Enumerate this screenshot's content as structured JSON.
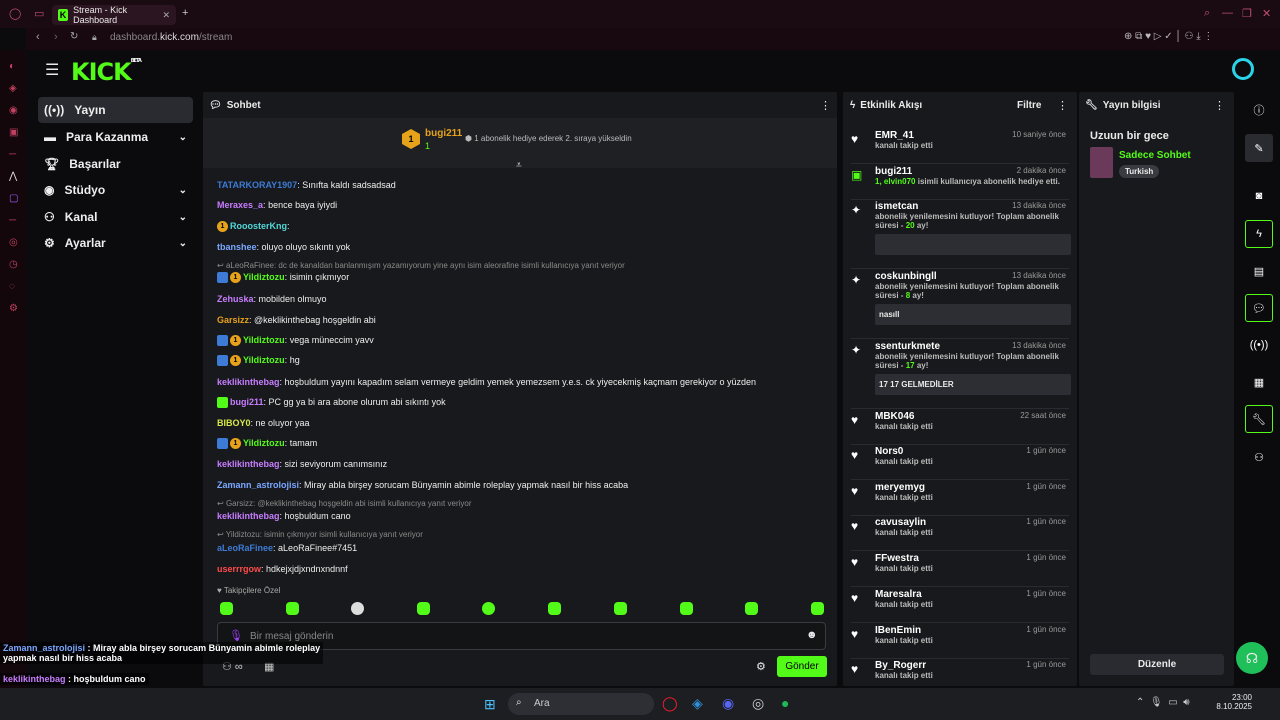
{
  "browser": {
    "tab_title": "Stream - Kick Dashboard",
    "address_domain_prefix": "dashboard.",
    "address_domain": "kick.com",
    "address_path": "/stream"
  },
  "brand": {
    "logo": "KICK",
    "beta": "BETA",
    "accent": "#53fc18"
  },
  "nav": [
    {
      "label": "Yayın",
      "icon": "broadcast-icon",
      "active": true
    },
    {
      "label": "Para Kazanma",
      "icon": "money-icon",
      "expandable": true
    },
    {
      "label": "Başarılar",
      "icon": "trophy-icon"
    },
    {
      "label": "Stüdyo",
      "icon": "studio-icon",
      "expandable": true
    },
    {
      "label": "Kanal",
      "icon": "channel-icon",
      "expandable": true
    },
    {
      "label": "Ayarlar",
      "icon": "settings-icon",
      "expandable": true
    }
  ],
  "chat": {
    "title": "Sohbet",
    "pinned": {
      "user": "bugi211",
      "count": "1",
      "text": "1 abonelik hediye ederek 2. sıraya yükseldin"
    },
    "messages": [
      {
        "user": "TATARKORAY1907",
        "color": "#3d7bd6",
        "text": "Sınıfta kaldı sadsadsad"
      },
      {
        "user": "Meraxes_a",
        "color": "#c77dff",
        "text": "bence baya iyiydi"
      },
      {
        "user": "RooosterKng",
        "color": "#53d8d8",
        "text": "",
        "badges": [
          "gold"
        ]
      },
      {
        "user": "tbanshee",
        "color": "#7aa7ff",
        "text": "oluyo oluyo sıkıntı yok"
      },
      {
        "reply": "aLeoRaFinee: dc de kanaldan banlanmışım yazamıyorum yine aynı isim aleorafine isimli kullanıcıya yanıt veriyor"
      },
      {
        "user": "Yildiztozu",
        "color": "#53fc18",
        "text": "isimin çıkmıyor",
        "badges": [
          "blue",
          "gold"
        ]
      },
      {
        "user": "Zehuska",
        "color": "#c77dff",
        "text": "mobilden olmuyo"
      },
      {
        "user": "Garsizz",
        "color": "#e7a21b",
        "text": "@keklikinthebag hoşgeldin abi"
      },
      {
        "user": "Yildiztozu",
        "color": "#53fc18",
        "text": "vega müneccim yavv",
        "badges": [
          "blue",
          "gold"
        ]
      },
      {
        "user": "Yildiztozu",
        "color": "#53fc18",
        "text": "hg",
        "badges": [
          "blue",
          "gold"
        ]
      },
      {
        "user": "keklikinthebag",
        "color": "#c77dff",
        "text": "hoşbuldum yayını kapadım selam vermeye geldim yemek yemezsem y.e.s. ck yiyecekmiş kaçmam gerekiyor o yüzden"
      },
      {
        "user": "bugi211",
        "color": "#c77dff",
        "text": "PC gg ya bi ara abone olurum abi sıkıntı yok",
        "badges": [
          "green"
        ]
      },
      {
        "user": "BIBOY0",
        "color": "#d6e84a",
        "text": "ne oluyor yaa"
      },
      {
        "user": "Yildiztozu",
        "color": "#53fc18",
        "text": "tamam",
        "badges": [
          "blue",
          "gold"
        ]
      },
      {
        "user": "keklikinthebag",
        "color": "#c77dff",
        "text": "sizi seviyorum canımsınız"
      },
      {
        "user": "Zamann_astrolojisi",
        "color": "#7aa7ff",
        "text": "Miray abla birşey sorucam Bünyamin abimle roleplay yapmak nasıl bir hiss acaba"
      },
      {
        "reply": "Garsizz: @keklikinthebag hoşgeldin abi isimli kullanıcıya yanıt veriyor"
      },
      {
        "user": "keklikinthebag",
        "color": "#c77dff",
        "text": "hoşbuldum cano"
      },
      {
        "reply": "Yildiztozu: isimin çıkmıyor isimli kullanıcıya yanıt veriyor"
      },
      {
        "user": "aLeoRaFinee",
        "color": "#3d7bd6",
        "text": "aLeoRaFinee#7451"
      },
      {
        "user": "userrrgow",
        "color": "#ff4b4b",
        "text": "hdkejxjdjxndnxndnnf"
      }
    ],
    "followers_only": "Takipçilere Özel",
    "input_placeholder": "Bir mesaj gönderin",
    "send_label": "Gönder"
  },
  "activity": {
    "title": "Etkinlik Akışı",
    "filter_label": "Filtre",
    "items": [
      {
        "name": "EMR_41",
        "desc": "kanalı takip etti",
        "time": "10 saniye önce",
        "icon": "heart-icon"
      },
      {
        "name": "bugi211",
        "desc_user": "1, elvin070",
        "desc": "isimli kullanıcıya abonelik hediye etti.",
        "time": "2 dakika önce",
        "icon": "gift-icon"
      },
      {
        "name": "ismetcan",
        "desc": "abonelik yenilemesini kutluyor! Toplam abonelik süresi -",
        "months": "20",
        "months_suffix": "ay!",
        "time": "13 dakika önce",
        "icon": "star-icon",
        "note": ""
      },
      {
        "name": "coskunbingll",
        "desc": "abonelik yenilemesini kutluyor! Toplam abonelik süresi -",
        "months": "8",
        "months_suffix": "ay!",
        "time": "13 dakika önce",
        "icon": "star-icon",
        "note": "nasıll"
      },
      {
        "name": "ssenturkmete",
        "desc": "abonelik yenilemesini kutluyor! Toplam abonelik süresi -",
        "months": "17",
        "months_suffix": "ay!",
        "time": "13 dakika önce",
        "icon": "star-icon",
        "note": "17 17 GELMEDİLER"
      },
      {
        "name": "MBK046",
        "desc": "kanalı takip etti",
        "time": "22 saat önce",
        "icon": "heart-icon"
      },
      {
        "name": "Nors0",
        "desc": "kanalı takip etti",
        "time": "1 gün önce",
        "icon": "heart-icon"
      },
      {
        "name": "meryemyg",
        "desc": "kanalı takip etti",
        "time": "1 gün önce",
        "icon": "heart-icon"
      },
      {
        "name": "cavusaylin",
        "desc": "kanalı takip etti",
        "time": "1 gün önce",
        "icon": "heart-icon"
      },
      {
        "name": "FFwestra",
        "desc": "kanalı takip etti",
        "time": "1 gün önce",
        "icon": "heart-icon"
      },
      {
        "name": "Maresalra",
        "desc": "kanalı takip etti",
        "time": "1 gün önce",
        "icon": "heart-icon"
      },
      {
        "name": "IBenEmin",
        "desc": "kanalı takip etti",
        "time": "1 gün önce",
        "icon": "heart-icon"
      },
      {
        "name": "By_Rogerr",
        "desc": "kanalı takip etti",
        "time": "1 gün önce",
        "icon": "heart-icon"
      }
    ]
  },
  "stream_info": {
    "title": "Yayın bilgisi",
    "stream_title": "Uzuun bir gece",
    "category": "Sadece Sohbet",
    "tag": "Turkish",
    "edit_label": "Düzenle"
  },
  "overlay": [
    {
      "user": "Zamann_astrolojisi",
      "color": "#7aa7ff",
      "text": "Miray abla birşey sorucam Bünyamin abimle roleplay",
      "text2": "yapmak nasıl bir hiss acaba"
    },
    {
      "user": "keklikinthebag",
      "color": "#c77dff",
      "text": "hoşbuldum cano"
    },
    {
      "user": "aLeoRaFinee",
      "color": "#3d7bd6",
      "text": "aLeoRaFinee#7451"
    },
    {
      "user": "userrrgow",
      "color": "#ff4b4b",
      "text": "hdkejxjdjxndnxndnnf"
    }
  ],
  "taskbar": {
    "search_placeholder": "Ara",
    "time": "23:00",
    "date": "8.10.2025"
  }
}
